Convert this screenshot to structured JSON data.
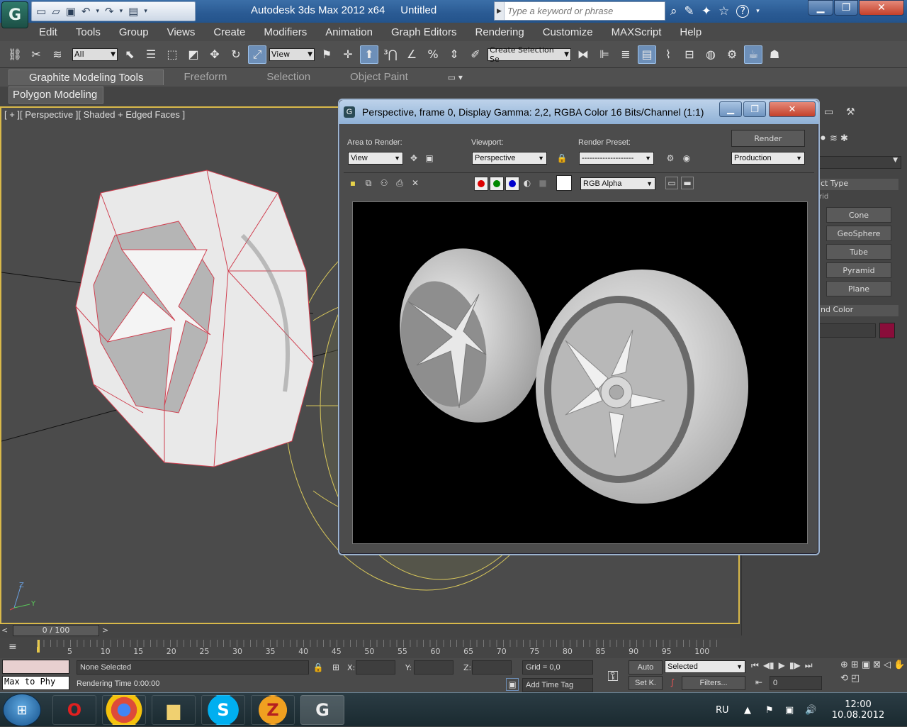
{
  "titlebar": {
    "app_name": "Autodesk 3ds Max  2012 x64",
    "doc_name": "Untitled",
    "search_placeholder": "Type a keyword or phrase",
    "logo_glyph": "G"
  },
  "menu": [
    "Edit",
    "Tools",
    "Group",
    "Views",
    "Create",
    "Modifiers",
    "Animation",
    "Graph Editors",
    "Rendering",
    "Customize",
    "MAXScript",
    "Help"
  ],
  "toolbar": {
    "selection_filter": "All",
    "ref_coord": "View",
    "named_selection": "Create Selection Se"
  },
  "ribbon": {
    "tabs": [
      "Graphite Modeling Tools",
      "Freeform",
      "Selection",
      "Object Paint"
    ],
    "active_tab": "Graphite Modeling Tools",
    "sub_panel": "Polygon Modeling"
  },
  "viewport": {
    "label": "[ + ][ Perspective ][ Shaded + Edged Faces ]",
    "axis_z": "Z",
    "axis_y": "Y"
  },
  "render_window": {
    "title": "Perspective, frame 0, Display Gamma: 2,2, RGBA Color 16 Bits/Channel (1:1)",
    "area_label": "Area to Render:",
    "area_value": "View",
    "viewport_label": "Viewport:",
    "viewport_value": "Perspective",
    "preset_label": "Render Preset:",
    "preset_value": "--------------------",
    "render_button": "Render",
    "production_value": "Production",
    "channel_value": "RGB Alpha"
  },
  "command_panel": {
    "object_type": "ct Type",
    "grid_label": "rid",
    "buttons": [
      "Cone",
      "GeoSphere",
      "Tube",
      "Pyramid",
      "Plane"
    ],
    "name_color": "nd Color",
    "swatch_color": "#8a0d3a"
  },
  "timeline": {
    "slider": "0 / 100",
    "ticks": [
      "5",
      "10",
      "15",
      "20",
      "25",
      "30",
      "35",
      "40",
      "45",
      "50",
      "55",
      "60",
      "65",
      "70",
      "75",
      "80",
      "85",
      "90",
      "95",
      "100"
    ]
  },
  "status": {
    "script_listener": "Max to Phy",
    "selection": "None Selected",
    "render_time": "Rendering Time  0:00:00",
    "x_label": "X:",
    "y_label": "Y:",
    "z_label": "Z:",
    "grid": "Grid = 0,0",
    "add_time_tag": "Add Time Tag",
    "auto": "Auto",
    "set_key": "Set K.",
    "key_mode": "Selected",
    "filters": "Filters...",
    "frame": "0"
  },
  "taskbar": {
    "lang": "RU",
    "time": "12:00",
    "date": "10.08.2012",
    "apps": [
      "opera",
      "chrome",
      "explorer",
      "skype",
      "filezilla",
      "3dsmax"
    ]
  }
}
